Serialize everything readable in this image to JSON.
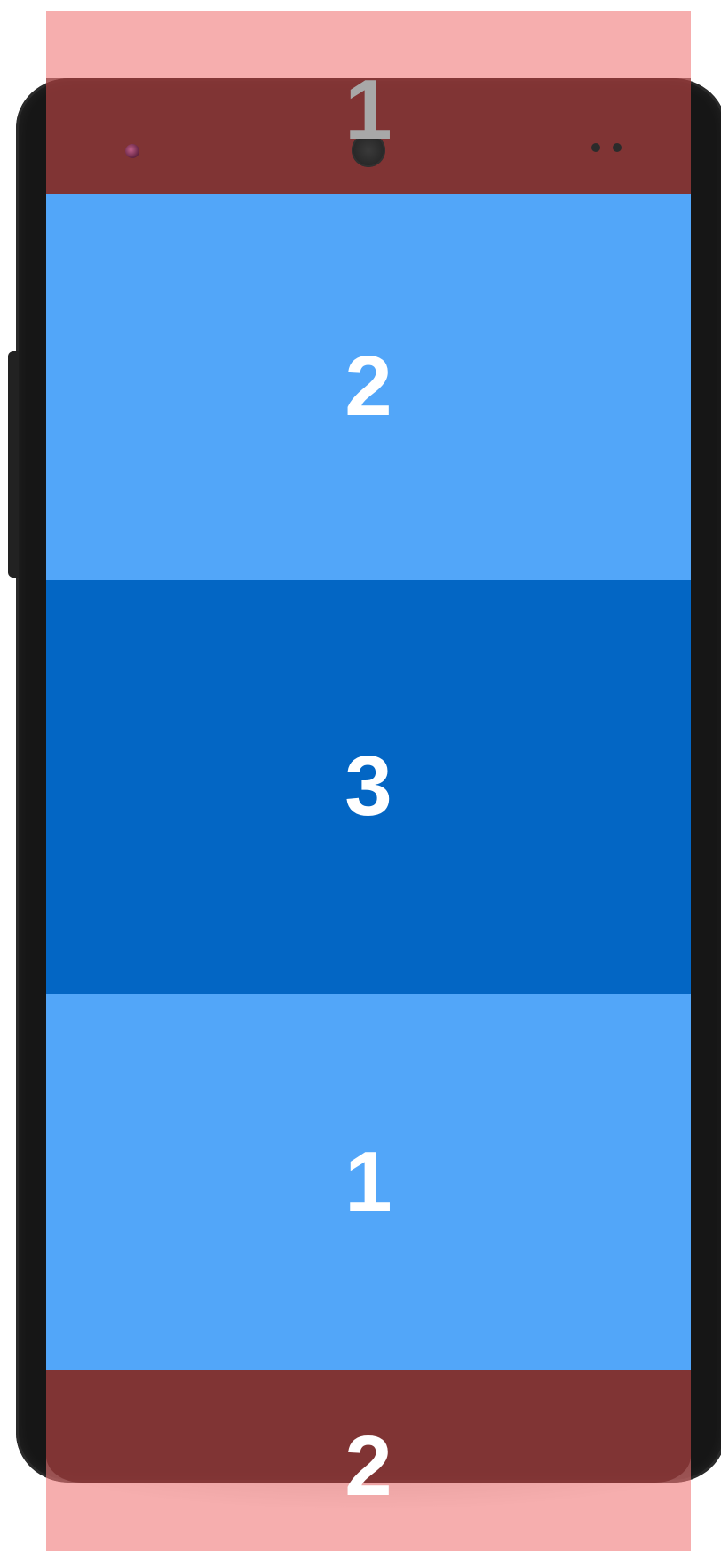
{
  "items": [
    {
      "label": "1",
      "color": "#a8a8a8"
    },
    {
      "label": "2",
      "color": "#52a6f9"
    },
    {
      "label": "3",
      "color": "#0366c4"
    },
    {
      "label": "1",
      "color": "#52a6f9"
    },
    {
      "label": "2",
      "color": "#7d3535"
    }
  ],
  "overlay_color": "#f28b8b"
}
